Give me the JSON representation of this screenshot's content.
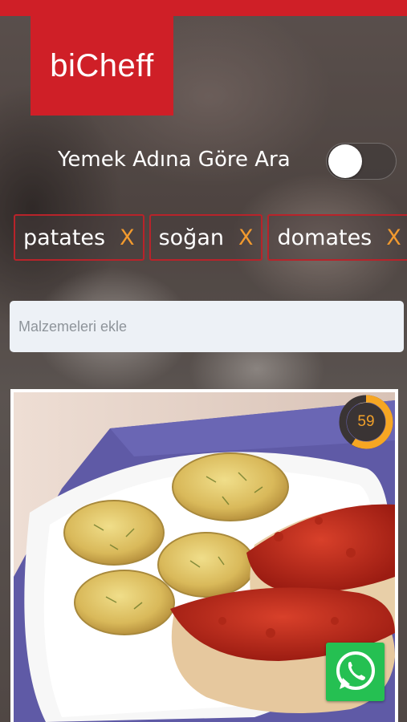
{
  "app": {
    "logo_text": "biCheff"
  },
  "search_mode": {
    "label": "Yemek Adına Göre Ara",
    "toggle_on": false
  },
  "ingredients": [
    {
      "label": "patates",
      "remove": "X"
    },
    {
      "label": "soğan",
      "remove": "X"
    },
    {
      "label": "domates",
      "remove": "X"
    }
  ],
  "ingredient_input": {
    "placeholder": "Malzemeleri ekle",
    "value": ""
  },
  "recipe_card": {
    "score": "59",
    "score_fraction": 0.59
  },
  "colors": {
    "brand_red": "#cf1f27",
    "accent_orange": "#f29a2e",
    "whatsapp_green": "#25c052"
  },
  "icons": {
    "share": "whatsapp-icon"
  }
}
